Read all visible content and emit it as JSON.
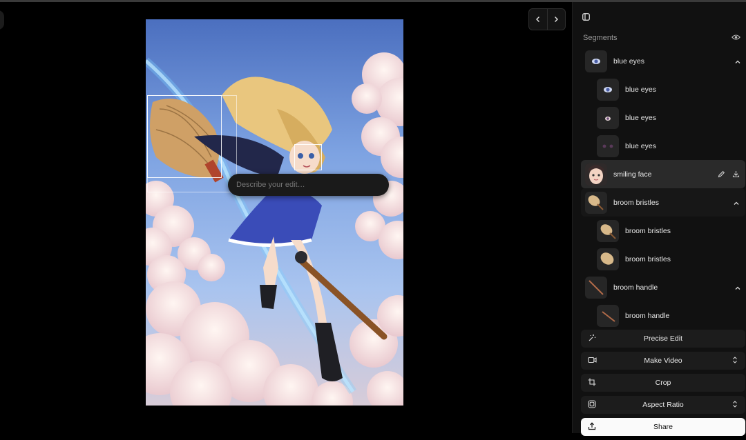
{
  "canvas": {
    "edit_placeholder": "Describe your edit…"
  },
  "panel": {
    "segments_title": "Segments",
    "segments": [
      {
        "label": "blue eyes",
        "level": 1
      },
      {
        "label": "blue eyes",
        "level": 2
      },
      {
        "label": "blue eyes",
        "level": 2
      },
      {
        "label": "blue eyes",
        "level": 2
      },
      {
        "label": "smiling face",
        "level": 1
      },
      {
        "label": "broom bristles",
        "level": 1
      },
      {
        "label": "broom bristles",
        "level": 2
      },
      {
        "label": "broom bristles",
        "level": 2
      },
      {
        "label": "broom handle",
        "level": 1
      },
      {
        "label": "broom handle",
        "level": 2
      }
    ]
  },
  "actions": {
    "precise_edit": "Precise Edit",
    "make_video": "Make Video",
    "crop": "Crop",
    "aspect_ratio": "Aspect Ratio",
    "share": "Share"
  },
  "icons": [
    "chevron-left-icon",
    "chevron-right-icon",
    "sidebar-toggle-icon",
    "eye-icon",
    "chevron-up-icon",
    "pencil-icon",
    "download-icon",
    "magic-wand-icon",
    "video-icon",
    "crop-icon",
    "aspect-ratio-icon",
    "share-icon",
    "up-down-chevron-icon"
  ]
}
